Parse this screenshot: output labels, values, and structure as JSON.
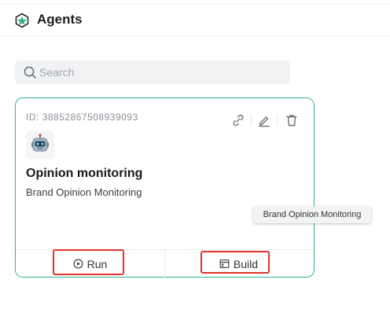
{
  "header": {
    "title": "Agents",
    "logo_icon": "agents-logo-icon"
  },
  "search": {
    "placeholder": "Search",
    "value": "",
    "icon": "search-icon"
  },
  "agent_card": {
    "id_label": "ID:",
    "id_value": "38852867508939093",
    "name": "Opinion monitoring",
    "description": "Brand Opinion Monitoring",
    "avatar": "robot",
    "accent_color": "#2fb48c",
    "actions": [
      "link-icon",
      "edit-icon",
      "delete-icon"
    ],
    "run_label": "Run",
    "build_label": "Build"
  },
  "tooltip": {
    "text": "Brand Opinion Monitoring"
  },
  "highlight_color": "#e03228"
}
